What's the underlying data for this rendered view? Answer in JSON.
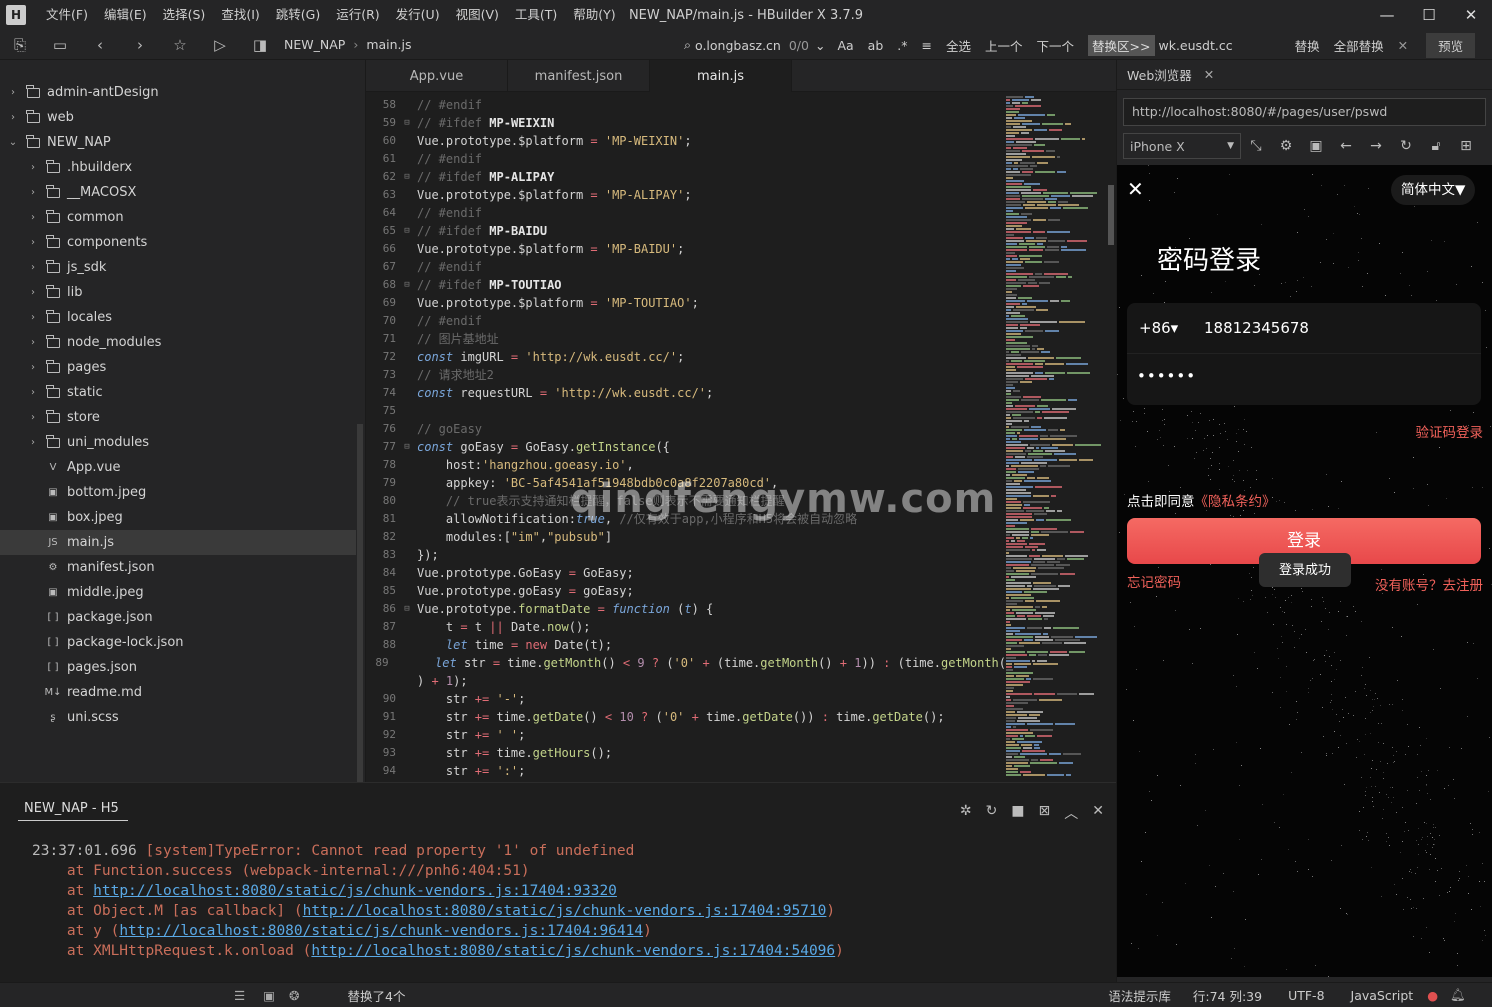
{
  "title_bar": {
    "menus": [
      "文件(F)",
      "编辑(E)",
      "选择(S)",
      "查找(I)",
      "跳转(G)",
      "运行(R)",
      "发行(U)",
      "视图(V)",
      "工具(T)",
      "帮助(Y)"
    ],
    "window_title": "NEW_NAP/main.js - HBuilder X 3.7.9"
  },
  "toolbar": {
    "breadcrumb": [
      "NEW_NAP",
      "main.js"
    ],
    "find_text": "o.longbasz.cn",
    "match_count": "0/0",
    "select_all": "全选",
    "prev": "上一个",
    "next": "下一个",
    "swap_area": "替换区>>",
    "replace_text": "wk.eusdt.cc",
    "replace": "替换",
    "replace_all": "全部替换",
    "preview": "预览"
  },
  "sidebar": {
    "items": [
      {
        "label": "admin-antDesign",
        "type": "folder",
        "depth": 0,
        "chev": "›"
      },
      {
        "label": "web",
        "type": "folder",
        "depth": 0,
        "chev": "›"
      },
      {
        "label": "NEW_NAP",
        "type": "project",
        "depth": 0,
        "chev": "⌄"
      },
      {
        "label": ".hbuilderx",
        "type": "folder",
        "depth": 1,
        "chev": "›"
      },
      {
        "label": "__MACOSX",
        "type": "folder",
        "depth": 1,
        "chev": "›"
      },
      {
        "label": "common",
        "type": "folder",
        "depth": 1,
        "chev": "›"
      },
      {
        "label": "components",
        "type": "folder",
        "depth": 1,
        "chev": "›"
      },
      {
        "label": "js_sdk",
        "type": "folder",
        "depth": 1,
        "chev": "›"
      },
      {
        "label": "lib",
        "type": "folder",
        "depth": 1,
        "chev": "›"
      },
      {
        "label": "locales",
        "type": "folder",
        "depth": 1,
        "chev": "›"
      },
      {
        "label": "node_modules",
        "type": "folder",
        "depth": 1,
        "chev": "›"
      },
      {
        "label": "pages",
        "type": "folder",
        "depth": 1,
        "chev": "›"
      },
      {
        "label": "static",
        "type": "folder",
        "depth": 1,
        "chev": "›"
      },
      {
        "label": "store",
        "type": "folder",
        "depth": 1,
        "chev": "›"
      },
      {
        "label": "uni_modules",
        "type": "folder",
        "depth": 1,
        "chev": "›"
      },
      {
        "label": "App.vue",
        "type": "file",
        "depth": 1,
        "chev": "",
        "glyph": "V"
      },
      {
        "label": "bottom.jpeg",
        "type": "file",
        "depth": 1,
        "chev": "",
        "glyph": "▣"
      },
      {
        "label": "box.jpeg",
        "type": "file",
        "depth": 1,
        "chev": "",
        "glyph": "▣"
      },
      {
        "label": "main.js",
        "type": "file",
        "depth": 1,
        "chev": "",
        "glyph": "JS",
        "selected": true
      },
      {
        "label": "manifest.json",
        "type": "file",
        "depth": 1,
        "chev": "",
        "glyph": "⚙"
      },
      {
        "label": "middle.jpeg",
        "type": "file",
        "depth": 1,
        "chev": "",
        "glyph": "▣"
      },
      {
        "label": "package.json",
        "type": "file",
        "depth": 1,
        "chev": "",
        "glyph": "[ ]"
      },
      {
        "label": "package-lock.json",
        "type": "file",
        "depth": 1,
        "chev": "",
        "glyph": "[ ]"
      },
      {
        "label": "pages.json",
        "type": "file",
        "depth": 1,
        "chev": "",
        "glyph": "[ ]"
      },
      {
        "label": "readme.md",
        "type": "file",
        "depth": 1,
        "chev": "",
        "glyph": "M↓"
      },
      {
        "label": "uni.scss",
        "type": "file",
        "depth": 1,
        "chev": "",
        "glyph": "ʂ"
      }
    ]
  },
  "editor": {
    "tabs": [
      {
        "label": "App.vue",
        "active": false
      },
      {
        "label": "manifest.json",
        "active": false
      },
      {
        "label": "main.js",
        "active": true
      }
    ],
    "lines": [
      {
        "n": "58",
        "fold": "",
        "html": "<span class='c-com'>// #endif</span>"
      },
      {
        "n": "59",
        "fold": "⊟",
        "html": "<span class='c-com'>// </span><span class='c-com'>#ifdef</span> <span class='c-dir'>MP-WEIXIN</span>"
      },
      {
        "n": "60",
        "fold": "",
        "html": "Vue.prototype.$platform <span class='c-op'>=</span> <span class='c-str'>'MP-WEIXIN'</span>;"
      },
      {
        "n": "61",
        "fold": "",
        "html": "<span class='c-com'>// #endif</span>"
      },
      {
        "n": "62",
        "fold": "⊟",
        "html": "<span class='c-com'>// #ifdef</span> <span class='c-dir'>MP-ALIPAY</span>"
      },
      {
        "n": "63",
        "fold": "",
        "html": "Vue.prototype.$platform <span class='c-op'>=</span> <span class='c-str'>'MP-ALIPAY'</span>;"
      },
      {
        "n": "64",
        "fold": "",
        "html": "<span class='c-com'>// #endif</span>"
      },
      {
        "n": "65",
        "fold": "⊟",
        "html": "<span class='c-com'>// #ifdef</span> <span class='c-dir'>MP-BAIDU</span>"
      },
      {
        "n": "66",
        "fold": "",
        "html": "Vue.prototype.$platform <span class='c-op'>=</span> <span class='c-str'>'MP-BAIDU'</span>;"
      },
      {
        "n": "67",
        "fold": "",
        "html": "<span class='c-com'>// #endif</span>"
      },
      {
        "n": "68",
        "fold": "⊟",
        "html": "<span class='c-com'>// #ifdef</span> <span class='c-dir'>MP-TOUTIAO</span>"
      },
      {
        "n": "69",
        "fold": "",
        "html": "Vue.prototype.$platform <span class='c-op'>=</span> <span class='c-str'>'MP-TOUTIAO'</span>;"
      },
      {
        "n": "70",
        "fold": "",
        "html": "<span class='c-com'>// #endif</span>"
      },
      {
        "n": "71",
        "fold": "",
        "html": "<span class='c-com'>// 图片基地址</span>"
      },
      {
        "n": "72",
        "fold": "",
        "html": "<span class='c-kw'>const</span> imgURL <span class='c-op'>=</span> <span class='c-str'>'http://wk.eusdt.cc/'</span>;"
      },
      {
        "n": "73",
        "fold": "",
        "html": "<span class='c-com'>// 请求地址2</span>"
      },
      {
        "n": "74",
        "fold": "",
        "html": "<span class='c-kw'>const</span> requestURL <span class='c-op'>=</span> <span class='c-str'>'http://wk.eusdt.cc/'</span>;"
      },
      {
        "n": "75",
        "fold": "",
        "html": ""
      },
      {
        "n": "76",
        "fold": "",
        "html": "<span class='c-com'>// goEasy</span>"
      },
      {
        "n": "77",
        "fold": "⊟",
        "html": "<span class='c-kw'>const</span> goEasy <span class='c-op'>=</span> GoEasy.<span class='c-fn'>getInstance</span>({"
      },
      {
        "n": "78",
        "fold": "",
        "html": "    host:<span class='c-str'>'hangzhou.goeasy.io'</span>,"
      },
      {
        "n": "79",
        "fold": "",
        "html": "    appkey: <span class='c-str'>'BC-5af4541af51948bdb0c0a8f2207a80cd'</span>,"
      },
      {
        "n": "80",
        "fold": "",
        "html": "    <span class='c-com'>// true表示支持通知栏提醒，false则表示不需要通知栏提醒</span>"
      },
      {
        "n": "81",
        "fold": "",
        "html": "    allowNotification:<span class='c-kw'>true</span>, <span class='c-com'>//仅有效于app,小程序和H5将会被自动忽略</span>"
      },
      {
        "n": "82",
        "fold": "",
        "html": "    modules:[<span class='c-str'>\"im\"</span>,<span class='c-str'>\"pubsub\"</span>]"
      },
      {
        "n": "83",
        "fold": "",
        "html": "});"
      },
      {
        "n": "84",
        "fold": "",
        "html": "Vue.prototype.GoEasy <span class='c-op'>=</span> GoEasy;"
      },
      {
        "n": "85",
        "fold": "",
        "html": "Vue.prototype.goEasy <span class='c-op'>=</span> goEasy;"
      },
      {
        "n": "86",
        "fold": "⊟",
        "html": "Vue.prototype.<span class='c-fn'>formatDate</span> <span class='c-op'>=</span> <span class='c-kw'>function</span> (<span class='c-kw'>t</span>) {"
      },
      {
        "n": "87",
        "fold": "",
        "html": "    t <span class='c-op'>=</span> t <span class='c-op'>||</span> Date.<span class='c-fn'>now</span>();"
      },
      {
        "n": "88",
        "fold": "",
        "html": "    <span class='c-kw'>let</span> time <span class='c-op'>=</span> <span class='c-op'>new</span> Date(t);"
      },
      {
        "n": "89",
        "fold": "",
        "html": "    <span class='c-kw'>let</span> str <span class='c-op'>=</span> time.<span class='c-fn'>getMonth</span>() <span class='c-op'>&lt;</span> <span class='c-num'>9</span> <span class='c-op'>?</span> (<span class='c-str'>'0'</span> <span class='c-op'>+</span> (time.<span class='c-fn'>getMonth</span>() <span class='c-op'>+</span> <span class='c-num'>1</span>)) <span class='c-op'>:</span> (time.<span class='c-fn'>getMonth</span>("
      },
      {
        "n": "",
        "fold": "",
        "html": ") <span class='c-op'>+</span> <span class='c-num'>1</span>);"
      },
      {
        "n": "90",
        "fold": "",
        "html": "    str <span class='c-op'>+=</span> <span class='c-str'>'-'</span>;"
      },
      {
        "n": "91",
        "fold": "",
        "html": "    str <span class='c-op'>+=</span> time.<span class='c-fn'>getDate</span>() <span class='c-op'>&lt;</span> <span class='c-num'>10</span> <span class='c-op'>?</span> (<span class='c-str'>'0'</span> <span class='c-op'>+</span> time.<span class='c-fn'>getDate</span>()) <span class='c-op'>:</span> time.<span class='c-fn'>getDate</span>();"
      },
      {
        "n": "92",
        "fold": "",
        "html": "    str <span class='c-op'>+=</span> <span class='c-str'>' '</span>;"
      },
      {
        "n": "93",
        "fold": "",
        "html": "    str <span class='c-op'>+=</span> time.<span class='c-fn'>getHours</span>();"
      },
      {
        "n": "94",
        "fold": "",
        "html": "    str <span class='c-op'>+=</span> <span class='c-str'>':'</span>;"
      }
    ],
    "watermark": "qingfengymw.com"
  },
  "browser": {
    "tab_label": "Web浏览器",
    "url": "http://localhost:8080/#/pages/user/pswd",
    "device": "iPhone X"
  },
  "phone": {
    "language": "简体中文▼",
    "title": "密码登录",
    "country_code": "+86▾",
    "phone_number": "18812345678",
    "password_mask": "••••••",
    "code_login": "验证码登录",
    "agree_prefix": "点击即同意",
    "agree_link": "《隐私条约》",
    "login_button": "登录",
    "toast": "登录成功",
    "forgot": "忘记密码",
    "register": "没有账号？去注册"
  },
  "console": {
    "tab": "NEW_NAP - H5",
    "lines": [
      {
        "ts": "23:37:01.696 ",
        "text": "[system]TypeError: Cannot read property '1' of undefined",
        "link": "",
        "tail": ""
      },
      {
        "ts": "    ",
        "text": "at Function.success (webpack-internal:///pnh6:404:51)",
        "link": "",
        "tail": ""
      },
      {
        "ts": "    ",
        "text": "at ",
        "link": "http://localhost:8080/static/js/chunk-vendors.js:17404:93320",
        "tail": ""
      },
      {
        "ts": "    ",
        "text": "at Object.M [as callback] (",
        "link": "http://localhost:8080/static/js/chunk-vendors.js:17404:95710",
        "tail": ")"
      },
      {
        "ts": "    ",
        "text": "at y (",
        "link": "http://localhost:8080/static/js/chunk-vendors.js:17404:96414",
        "tail": ")"
      },
      {
        "ts": "    ",
        "text": "at XMLHttpRequest.k.onload (",
        "link": "http://localhost:8080/static/js/chunk-vendors.js:17404:54096",
        "tail": ")"
      }
    ]
  },
  "status_bar": {
    "message": "替换了4个",
    "syntax_hint": "语法提示库",
    "position": "行:74  列:39",
    "encoding": "UTF-8",
    "language": "JavaScript"
  }
}
